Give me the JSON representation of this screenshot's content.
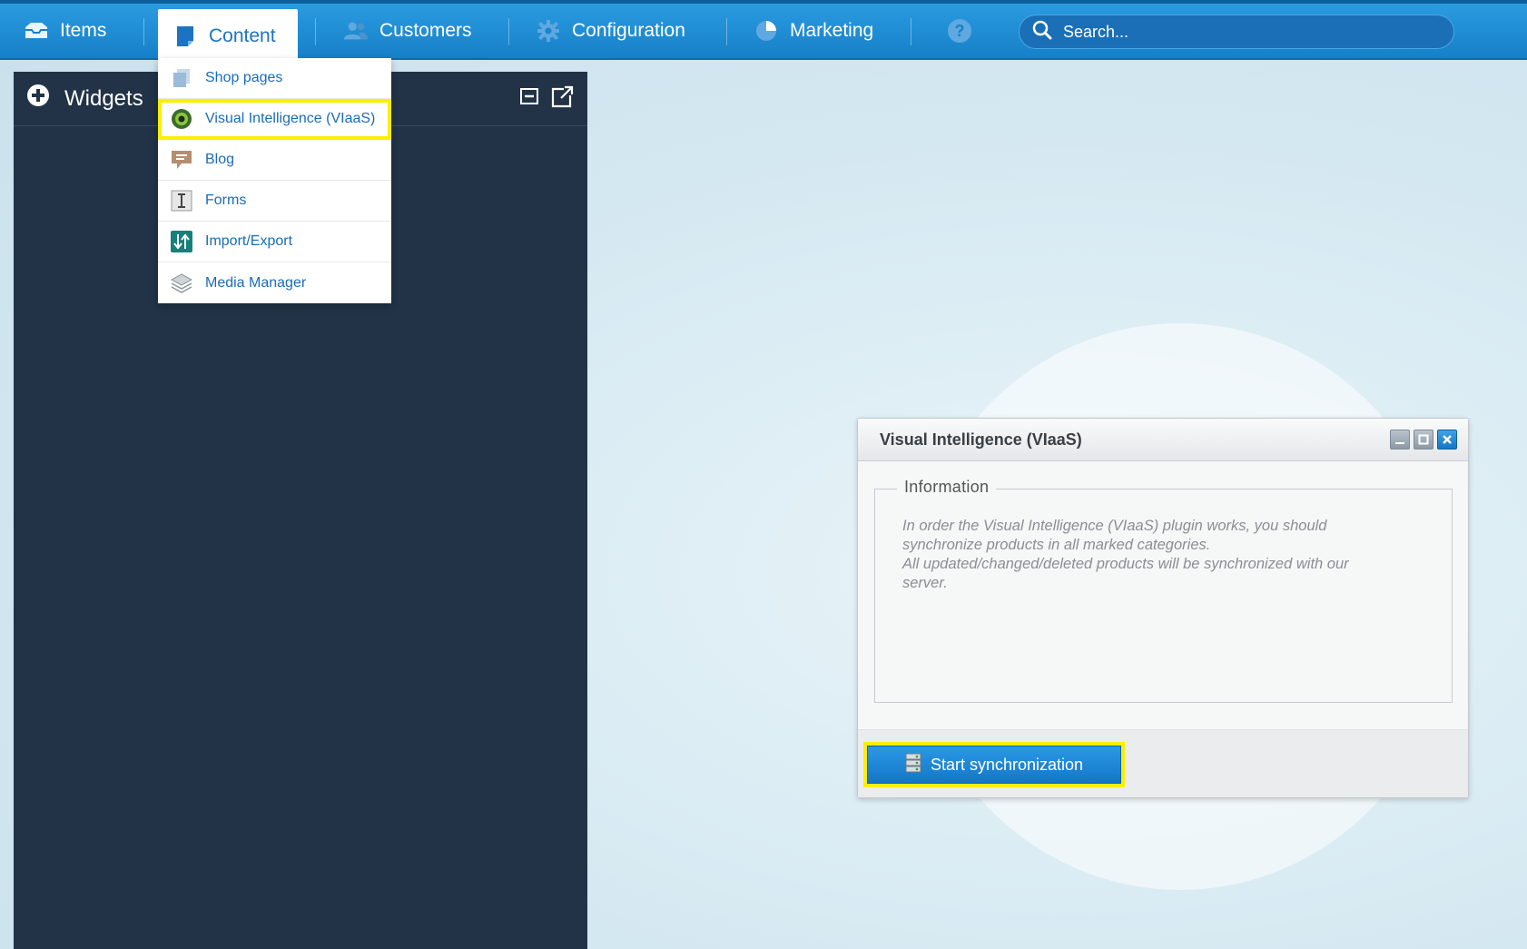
{
  "nav": {
    "items": [
      {
        "label": "Items",
        "icon": "inbox-icon"
      },
      {
        "label": "Content",
        "icon": "page-icon",
        "active": true
      },
      {
        "label": "Customers",
        "icon": "users-icon"
      },
      {
        "label": "Configuration",
        "icon": "gear-icon"
      },
      {
        "label": "Marketing",
        "icon": "pie-chart-icon"
      },
      {
        "label": "",
        "icon": "help-icon"
      }
    ],
    "search_placeholder": "Search..."
  },
  "content_menu": {
    "items": [
      {
        "label": "Shop pages",
        "icon": "pages-icon"
      },
      {
        "label": "Visual Intelligence (VIaaS)",
        "icon": "vision-eye-icon",
        "highlighted": true
      },
      {
        "label": "Blog",
        "icon": "speech-bubble-icon"
      },
      {
        "label": "Forms",
        "icon": "text-cursor-icon"
      },
      {
        "label": "Import/Export",
        "icon": "arrows-updown-icon"
      },
      {
        "label": "Media Manager",
        "icon": "layers-icon"
      }
    ]
  },
  "widgets": {
    "title": "Widgets"
  },
  "dialog": {
    "title": "Visual Intelligence (VIaaS)",
    "legend": "Information",
    "text_lines": [
      "In order the Visual Intelligence (VIaaS) plugin works, you should",
      "synchronize products in all marked categories.",
      "All updated/changed/deleted products will be synchronized with our",
      "server."
    ],
    "button_label": "Start synchronization"
  },
  "colors": {
    "nav_blue": "#1b8bd6",
    "panel_dark": "#223347",
    "highlight": "#ffee00",
    "link_blue": "#1a6cb8"
  }
}
